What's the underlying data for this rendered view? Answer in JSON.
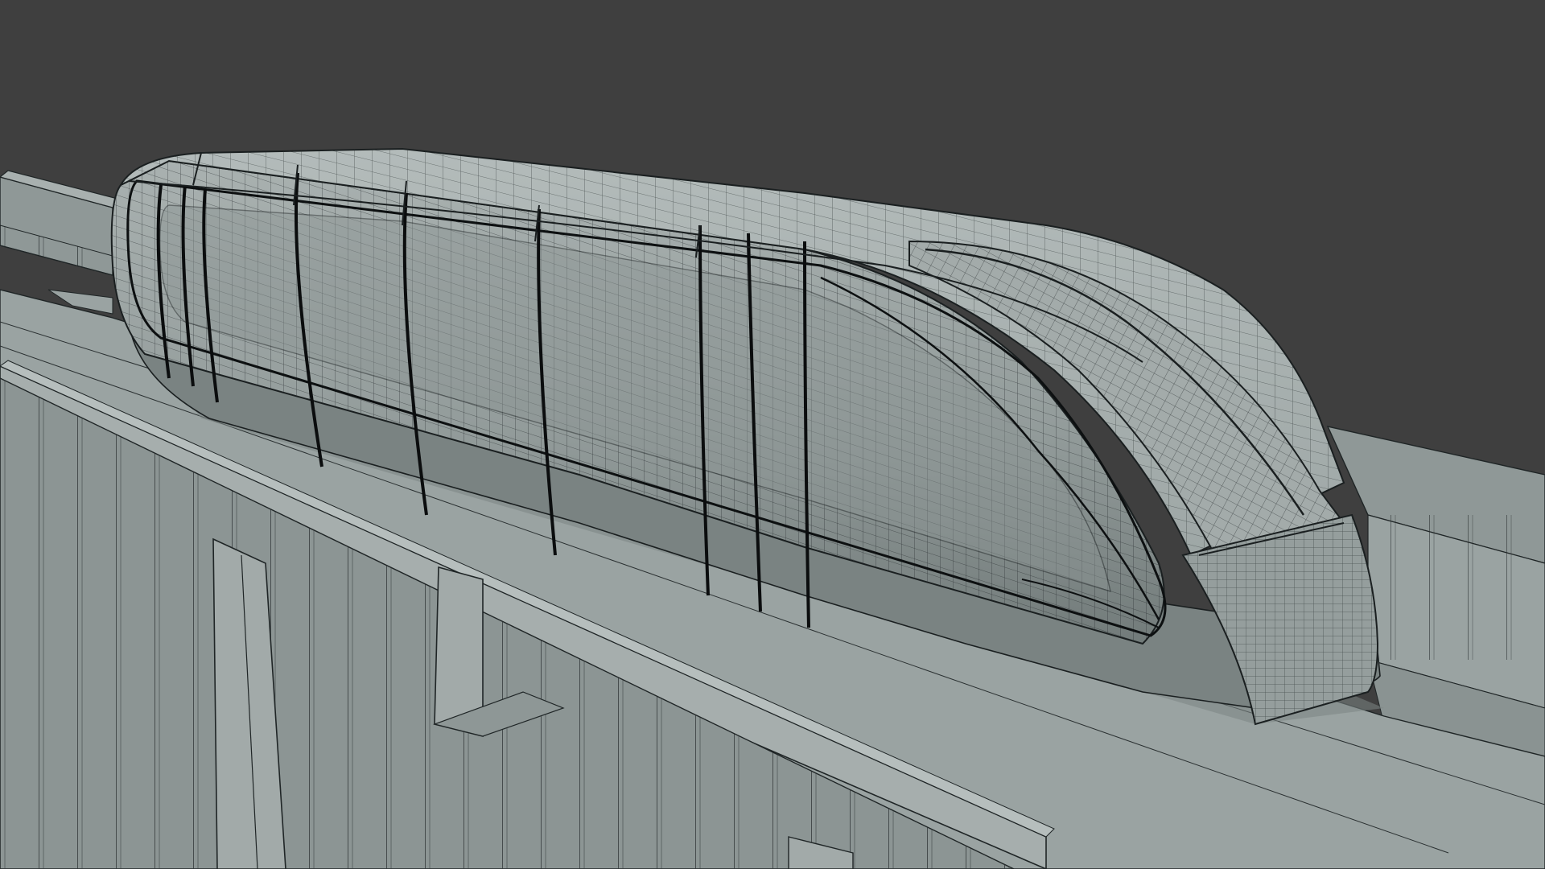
{
  "viewport": {
    "background_color": "#3f3f3f",
    "model_fill_color": "#97a09f",
    "model_shadow_color": "#6f7877",
    "wire_color": "#1d2223",
    "seam_color": "#0b0d0e",
    "ground_color": "#8d9695"
  },
  "scene": {
    "objects": [
      "monorail-train",
      "elevated-guideway",
      "support-pillars",
      "ground-plane",
      "background-guideway"
    ],
    "display_mode": "wireframe-on-shaded"
  }
}
